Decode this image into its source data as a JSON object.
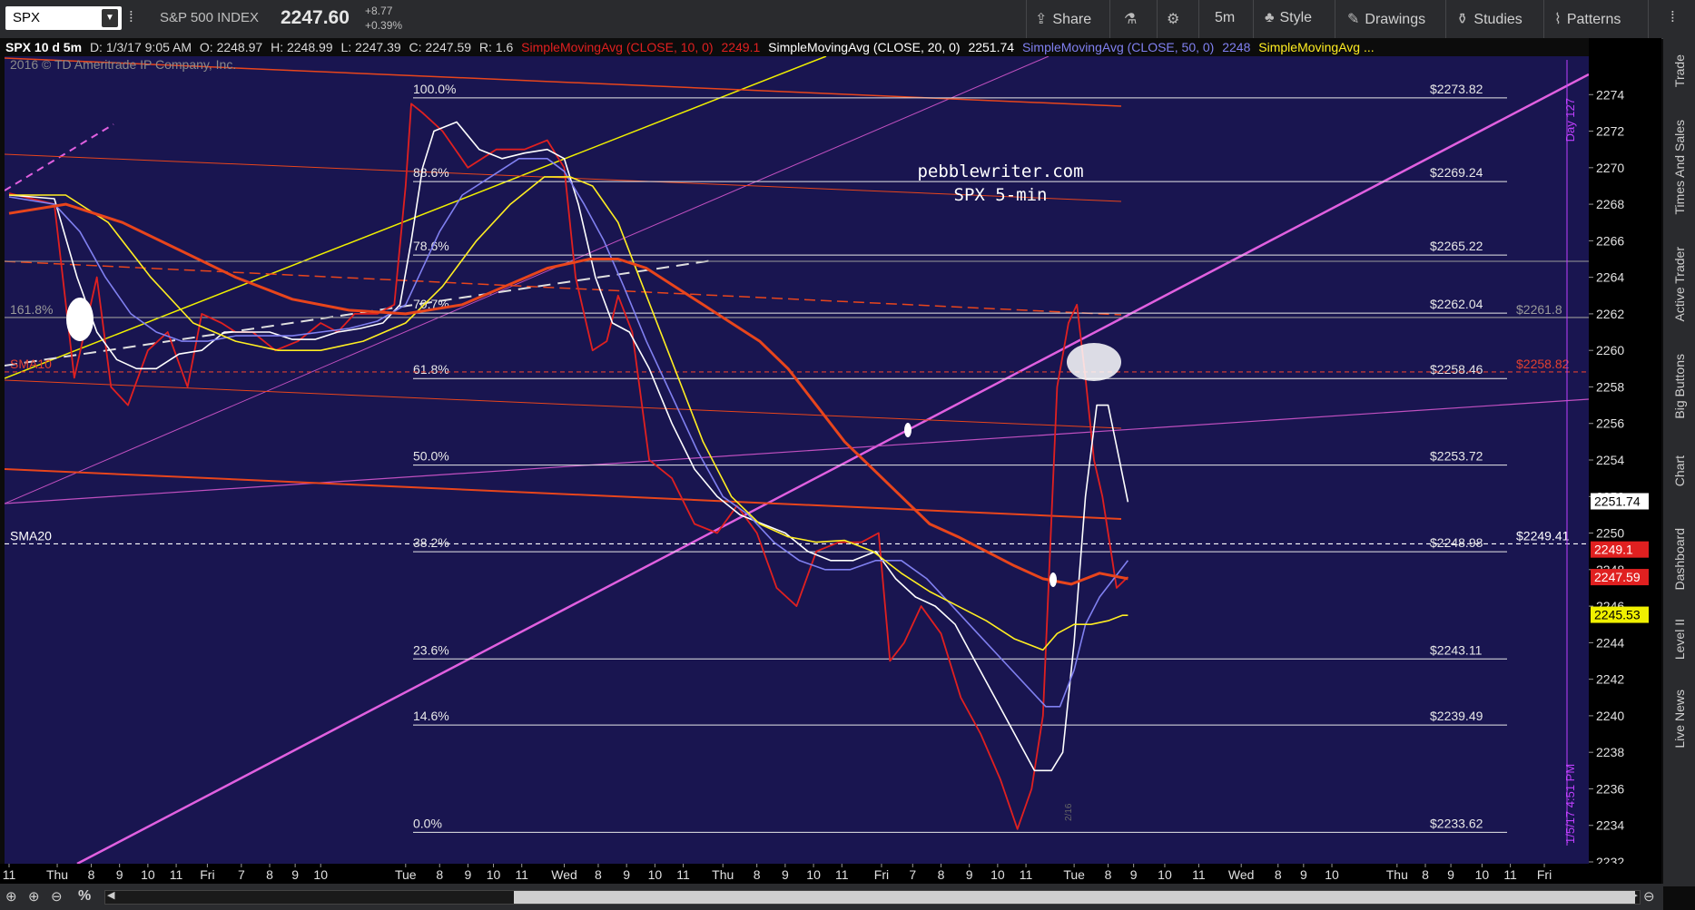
{
  "toolbar": {
    "symbol": "SPX",
    "index_name": "S&P 500 INDEX",
    "price": "2247.60",
    "change": "+8.77",
    "change_pct": "+0.39%",
    "buttons": {
      "share": "Share",
      "interval": "5m",
      "style": "Style",
      "drawings": "Drawings",
      "studies": "Studies",
      "patterns": "Patterns"
    }
  },
  "infobar": {
    "title": "SPX 10 d 5m",
    "date": "D: 1/3/17 9:05 AM",
    "open": "O: 2248.97",
    "high": "H: 2248.99",
    "low": "L: 2247.39",
    "close": "C: 2247.59",
    "range": "R: 1.6",
    "sma10_label": "SimpleMovingAvg (CLOSE, 10, 0)",
    "sma10_value": "2249.1",
    "sma20_label": "SimpleMovingAvg (CLOSE, 20, 0)",
    "sma20_value": "2251.74",
    "sma50_label": "SimpleMovingAvg (CLOSE, 50, 0)",
    "sma50_value": "2248",
    "sma_more_label": "SimpleMovingAvg ..."
  },
  "right_sidebar": [
    "Trade",
    "Times And Sales",
    "Active Trader",
    "Big Buttons",
    "Chart",
    "Dashboard",
    "Level II",
    "Live News"
  ],
  "chart_data": {
    "type": "line",
    "copyright": "2016 © TD Ameritrade IP Company, Inc.",
    "watermark_line1": "pebblewriter.com",
    "watermark_line2": "SPX 5-min",
    "ylim": [
      2232,
      2276
    ],
    "y_ticks": [
      "2232",
      "2234",
      "2236",
      "2238",
      "2240",
      "2242",
      "2244",
      "2246",
      "2248",
      "2250",
      "2252",
      "2254",
      "2256",
      "2258",
      "2260",
      "2262",
      "2264",
      "2266",
      "2268",
      "2270",
      "2272",
      "2274"
    ],
    "x_tick_labels": [
      {
        "t": 0.0,
        "label": "11"
      },
      {
        "t": 1.7,
        "label": "Thu"
      },
      {
        "t": 2.9,
        "label": "8"
      },
      {
        "t": 3.9,
        "label": "9"
      },
      {
        "t": 4.9,
        "label": "10"
      },
      {
        "t": 5.9,
        "label": "11"
      },
      {
        "t": 7.0,
        "label": "Fri"
      },
      {
        "t": 8.2,
        "label": "7"
      },
      {
        "t": 9.2,
        "label": "8"
      },
      {
        "t": 10.1,
        "label": "9"
      },
      {
        "t": 11.0,
        "label": "10"
      },
      {
        "t": 14.0,
        "label": "Tue"
      },
      {
        "t": 15.2,
        "label": "8"
      },
      {
        "t": 16.2,
        "label": "9"
      },
      {
        "t": 17.1,
        "label": "10"
      },
      {
        "t": 18.1,
        "label": "11"
      },
      {
        "t": 19.6,
        "label": "Wed"
      },
      {
        "t": 20.8,
        "label": "8"
      },
      {
        "t": 21.8,
        "label": "9"
      },
      {
        "t": 22.8,
        "label": "10"
      },
      {
        "t": 23.8,
        "label": "11"
      },
      {
        "t": 25.2,
        "label": "Thu"
      },
      {
        "t": 26.4,
        "label": "8"
      },
      {
        "t": 27.4,
        "label": "9"
      },
      {
        "t": 28.4,
        "label": "10"
      },
      {
        "t": 29.4,
        "label": "11"
      },
      {
        "t": 30.8,
        "label": "Fri"
      },
      {
        "t": 31.9,
        "label": "7"
      },
      {
        "t": 32.9,
        "label": "8"
      },
      {
        "t": 33.9,
        "label": "9"
      },
      {
        "t": 34.9,
        "label": "10"
      },
      {
        "t": 35.9,
        "label": "11"
      },
      {
        "t": 37.6,
        "label": "Tue"
      },
      {
        "t": 38.8,
        "label": "8"
      },
      {
        "t": 39.7,
        "label": "9"
      },
      {
        "t": 40.8,
        "label": "10"
      },
      {
        "t": 42.0,
        "label": "11"
      },
      {
        "t": 43.5,
        "label": "Wed"
      },
      {
        "t": 44.8,
        "label": "8"
      },
      {
        "t": 45.7,
        "label": "9"
      },
      {
        "t": 46.7,
        "label": "10"
      },
      {
        "t": 49.0,
        "label": "Thu"
      },
      {
        "t": 50.0,
        "label": "8"
      },
      {
        "t": 50.9,
        "label": "9"
      },
      {
        "t": 52.0,
        "label": "10"
      },
      {
        "t": 53.0,
        "label": "11"
      },
      {
        "t": 54.2,
        "label": "Fri"
      }
    ],
    "fib_levels": [
      {
        "pct": "100.0%",
        "price": 2273.82,
        "label": "$2273.82"
      },
      {
        "pct": "88.6%",
        "price": 2269.24,
        "label": "$2269.24"
      },
      {
        "pct": "78.6%",
        "price": 2265.22,
        "label": "$2265.22"
      },
      {
        "pct": "70.7%",
        "price": 2262.04,
        "label": "$2262.04"
      },
      {
        "pct": "61.8%",
        "price": 2258.46,
        "label": "$2258.46"
      },
      {
        "pct": "50.0%",
        "price": 2253.72,
        "label": "$2253.72"
      },
      {
        "pct": "38.2%",
        "price": 2248.98,
        "label": "$2248.98"
      },
      {
        "pct": "23.6%",
        "price": 2243.11,
        "label": "$2243.11"
      },
      {
        "pct": "14.6%",
        "price": 2239.49,
        "label": "$2239.49"
      },
      {
        "pct": "0.0%",
        "price": 2233.62,
        "label": "$2233.62"
      }
    ],
    "hlines": [
      {
        "name": "161.8%",
        "price": 2261.8,
        "label": "$2261.8",
        "color": "#9a9a9a",
        "dash": false
      },
      {
        "name": "SMA10",
        "price": 2258.82,
        "label": "$2258.82",
        "color": "#e04030",
        "dash": true
      },
      {
        "name": "SMA20",
        "price": 2249.41,
        "label": "$2249.41",
        "color": "#ffffff",
        "dash": true
      }
    ],
    "price_badges": [
      {
        "label": "2251.74",
        "price": 2251.74,
        "bg": "#ffffff",
        "fg": "#000000"
      },
      {
        "label": "2249.1",
        "price": 2249.1,
        "bg": "#e02020",
        "fg": "#ffffff"
      },
      {
        "label": "2247.59",
        "price": 2247.59,
        "bg": "#e02020",
        "fg": "#ffffff"
      },
      {
        "label": "2245.53",
        "price": 2245.53,
        "bg": "#f0f000",
        "fg": "#000000"
      }
    ],
    "vertical_labels": {
      "top": "Day 127",
      "bottom": "1/5/17 4:51 PM",
      "bar_label": "2/16"
    },
    "series": [
      {
        "color": "#e02020",
        "x": [
          0,
          1.6,
          2.3,
          3.1,
          3.6,
          4.2,
          4.9,
          5.6,
          6.3,
          6.8,
          7.5,
          8.0,
          8.6,
          9.4,
          10.2,
          11.0,
          11.6,
          12.2,
          13.0,
          13.6,
          14.0,
          14.2,
          14.6,
          15.3,
          16.2,
          17.2,
          18.2,
          19.0,
          19.6,
          20.0,
          20.6,
          21.1,
          21.5,
          22.0,
          22.6,
          23.4,
          24.2,
          25.0,
          25.7,
          26.4,
          27.1,
          27.8,
          28.5,
          29.3,
          30.1,
          30.7,
          31.1,
          31.6,
          32.2,
          32.9,
          33.6,
          34.3,
          35.0,
          35.6,
          36.1,
          36.5,
          37.0,
          37.4,
          37.7,
          38.0,
          38.3,
          38.6,
          38.9,
          39.1,
          39.3,
          39.5
        ],
        "y": [
          2268.6,
          2268.0,
          2258.5,
          2264.0,
          2258.0,
          2257.0,
          2260.0,
          2261.0,
          2258.0,
          2262.0,
          2261.5,
          2261.0,
          2261.0,
          2260.0,
          2260.5,
          2261.5,
          2261.0,
          2262.0,
          2262.0,
          2262.5,
          2269.0,
          2273.5,
          2273.0,
          2272.0,
          2270.0,
          2271.0,
          2271.0,
          2271.5,
          2270.0,
          2264.0,
          2260.0,
          2260.5,
          2263.0,
          2261.0,
          2254.0,
          2253.0,
          2250.5,
          2250.0,
          2251.5,
          2250.0,
          2247.0,
          2246.0,
          2249.0,
          2249.5,
          2249.5,
          2250.0,
          2243.0,
          2244.0,
          2246.0,
          2244.5,
          2241.0,
          2239.0,
          2236.5,
          2233.8,
          2236.0,
          2240.0,
          2258.0,
          2261.5,
          2262.5,
          2258.5,
          2254.0,
          2252.0,
          2249.0,
          2247.0,
          2247.3,
          2247.6
        ]
      },
      {
        "color": "#ffffff",
        "x": [
          0,
          1.6,
          2.4,
          3.1,
          3.8,
          4.5,
          5.2,
          6.0,
          6.8,
          7.6,
          8.4,
          9.2,
          10.0,
          10.8,
          11.6,
          12.4,
          13.2,
          13.8,
          14.2,
          14.6,
          15.0,
          15.8,
          16.6,
          17.4,
          18.2,
          19.0,
          19.6,
          20.1,
          20.7,
          21.3,
          21.9,
          22.6,
          23.4,
          24.2,
          25.0,
          25.8,
          26.6,
          27.4,
          28.2,
          29.0,
          29.8,
          30.6,
          31.3,
          32.0,
          32.7,
          33.4,
          34.1,
          34.8,
          35.5,
          36.2,
          36.8,
          37.2,
          37.6,
          38.0,
          38.4,
          38.8,
          39.2,
          39.5
        ],
        "y": [
          2268.5,
          2268.3,
          2264.0,
          2261.0,
          2259.5,
          2259.0,
          2259.0,
          2259.8,
          2260.0,
          2261.0,
          2261.0,
          2261.0,
          2260.6,
          2260.6,
          2261.0,
          2261.2,
          2261.5,
          2262.5,
          2266.0,
          2270.0,
          2272.0,
          2272.5,
          2271.0,
          2270.5,
          2270.8,
          2271.0,
          2270.5,
          2268.0,
          2264.0,
          2261.5,
          2261.0,
          2259.0,
          2256.0,
          2253.5,
          2252.0,
          2251.0,
          2250.5,
          2250.0,
          2249.0,
          2248.5,
          2248.5,
          2249.0,
          2247.5,
          2246.5,
          2246.0,
          2245.0,
          2243.0,
          2241.0,
          2239.0,
          2237.0,
          2237.0,
          2238.0,
          2244.0,
          2252.0,
          2257.0,
          2257.0,
          2254.0,
          2251.7
        ]
      },
      {
        "color": "#8080f0",
        "x": [
          0,
          1.6,
          2.5,
          3.4,
          4.3,
          5.2,
          6.1,
          7.0,
          8.0,
          9.0,
          10.0,
          11.0,
          12.0,
          13.0,
          14.0,
          14.6,
          15.2,
          16.0,
          17.0,
          18.0,
          19.0,
          19.6,
          20.3,
          21.0,
          21.7,
          22.5,
          23.4,
          24.3,
          25.2,
          26.1,
          27.0,
          27.9,
          28.8,
          29.7,
          30.6,
          31.5,
          32.4,
          33.3,
          34.2,
          35.1,
          36.0,
          36.6,
          37.1,
          37.6,
          38.0,
          38.5,
          39.0,
          39.5
        ],
        "y": [
          2268.4,
          2268.0,
          2266.5,
          2264.0,
          2262.0,
          2261.0,
          2260.5,
          2260.5,
          2260.8,
          2260.8,
          2260.8,
          2261.0,
          2261.2,
          2261.6,
          2262.5,
          2264.5,
          2266.5,
          2268.5,
          2269.5,
          2270.5,
          2270.5,
          2269.8,
          2268.0,
          2266.0,
          2263.5,
          2260.5,
          2257.5,
          2254.5,
          2252.0,
          2251.0,
          2249.5,
          2248.5,
          2248.0,
          2248.0,
          2248.5,
          2248.5,
          2247.5,
          2246.0,
          2244.5,
          2243.0,
          2241.5,
          2240.5,
          2240.5,
          2242.5,
          2245.0,
          2246.5,
          2247.5,
          2248.5
        ]
      },
      {
        "color": "#ffee22",
        "x": [
          0,
          2.0,
          3.5,
          5.0,
          6.5,
          8.0,
          9.5,
          11.0,
          12.5,
          14.0,
          15.3,
          16.5,
          17.7,
          18.9,
          19.8,
          20.6,
          21.5,
          22.5,
          23.5,
          24.5,
          25.5,
          26.5,
          27.5,
          28.5,
          29.5,
          30.5,
          31.5,
          32.5,
          33.5,
          34.5,
          35.5,
          36.5,
          37.0,
          37.6,
          38.2,
          38.8,
          39.3,
          39.5
        ],
        "y": [
          2268.5,
          2268.5,
          2267.0,
          2264.0,
          2261.5,
          2260.5,
          2260.0,
          2260.0,
          2260.5,
          2261.5,
          2263.5,
          2266.0,
          2268.0,
          2269.5,
          2269.5,
          2269.0,
          2267.0,
          2263.0,
          2259.0,
          2255.0,
          2252.0,
          2250.5,
          2249.8,
          2249.5,
          2249.6,
          2249.0,
          2247.8,
          2246.8,
          2246.0,
          2245.2,
          2244.2,
          2243.6,
          2244.5,
          2245.0,
          2245.0,
          2245.2,
          2245.5,
          2245.5
        ]
      },
      {
        "color": "#e8451c",
        "x": [
          0,
          2.0,
          4.0,
          6.0,
          8.0,
          10.0,
          12.0,
          14.0,
          16.0,
          17.5,
          19.0,
          20.5,
          21.5,
          22.5,
          23.5,
          24.5,
          25.5,
          26.5,
          27.5,
          28.5,
          29.5,
          30.5,
          31.5,
          32.5,
          33.5,
          34.5,
          35.5,
          36.5,
          37.5,
          38.5,
          39.5
        ],
        "y": [
          2267.5,
          2268.0,
          2267.0,
          2265.5,
          2264.0,
          2262.8,
          2262.2,
          2262.0,
          2262.5,
          2263.5,
          2264.5,
          2265.0,
          2265.0,
          2264.5,
          2263.5,
          2262.5,
          2261.5,
          2260.5,
          2259.0,
          2257.0,
          2255.0,
          2253.5,
          2252.0,
          2250.5,
          2249.8,
          2249.0,
          2248.2,
          2247.5,
          2247.2,
          2247.8,
          2247.5
        ]
      }
    ]
  },
  "bottombar": {
    "zoom_pct": "%"
  }
}
